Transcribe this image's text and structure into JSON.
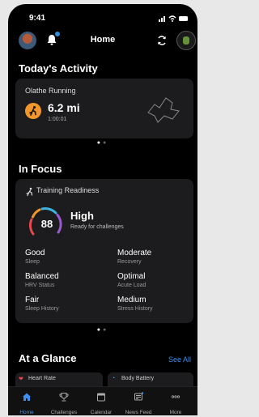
{
  "status": {
    "time": "9:41"
  },
  "header": {
    "title": "Home"
  },
  "today": {
    "heading": "Today's Activity",
    "activity_name": "Olathe Running",
    "distance": "6.2 mi",
    "duration": "1:00:01"
  },
  "focus": {
    "heading": "In Focus",
    "card_title": "Training Readiness",
    "score": "88",
    "level": "High",
    "subtitle": "Ready for challenges",
    "metrics": [
      {
        "value": "Good",
        "label": "Sleep"
      },
      {
        "value": "Moderate",
        "label": "Recovery"
      },
      {
        "value": "Balanced",
        "label": "HRV Status"
      },
      {
        "value": "Optimal",
        "label": "Acute Load"
      },
      {
        "value": "Fair",
        "label": "Sleep History"
      },
      {
        "value": "Medium",
        "label": "Stress History"
      }
    ]
  },
  "glance": {
    "heading": "At a Glance",
    "see_all": "See All",
    "cards": [
      "Heart Rate",
      "Body Battery"
    ]
  },
  "tabs": [
    {
      "label": "Home",
      "active": true
    },
    {
      "label": "Challenges"
    },
    {
      "label": "Calendar"
    },
    {
      "label": "News Feed"
    },
    {
      "label": "More"
    }
  ],
  "colors": {
    "accent": "#3d8ff0",
    "run": "#f0962a",
    "card": "#1c1c1e",
    "background": "#000000"
  }
}
